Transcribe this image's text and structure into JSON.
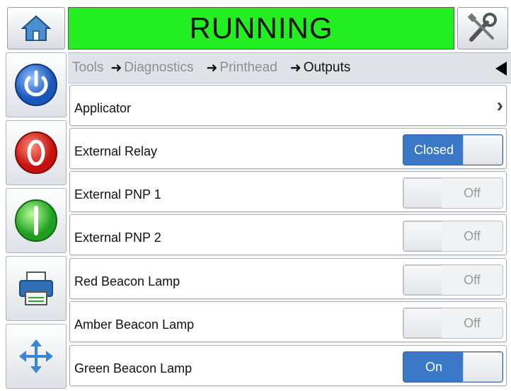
{
  "header": {
    "status": "RUNNING",
    "status_color": "#22ee22",
    "home_icon": "home-icon",
    "tools_icon": "tools-icon"
  },
  "sidebar": {
    "buttons": [
      {
        "name": "power-button",
        "icon": "power-icon"
      },
      {
        "name": "stop-button",
        "icon": "stop-icon"
      },
      {
        "name": "start-button",
        "icon": "start-icon"
      },
      {
        "name": "print-button",
        "icon": "printer-icon"
      },
      {
        "name": "navigate-button",
        "icon": "arrows-icon"
      }
    ]
  },
  "breadcrumb": {
    "items": [
      "Tools",
      "Diagnostics",
      "Printhead",
      "Outputs"
    ],
    "back_icon": "back-triangle-icon"
  },
  "outputs": [
    {
      "label": "Applicator",
      "type": "submenu"
    },
    {
      "label": "External Relay",
      "type": "toggle",
      "state": "Closed",
      "on": true
    },
    {
      "label": "External PNP 1",
      "type": "toggle",
      "state": "Off",
      "on": false
    },
    {
      "label": "External PNP 2",
      "type": "toggle",
      "state": "Off",
      "on": false
    },
    {
      "label": "Red Beacon Lamp",
      "type": "toggle",
      "state": "Off",
      "on": false
    },
    {
      "label": "Amber Beacon Lamp",
      "type": "toggle",
      "state": "Off",
      "on": false
    },
    {
      "label": "Green Beacon Lamp",
      "type": "toggle",
      "state": "On",
      "on": true
    }
  ],
  "colors": {
    "accent_blue": "#3b78c8",
    "stop_red": "#e0201c",
    "start_green": "#2ecc2e"
  }
}
